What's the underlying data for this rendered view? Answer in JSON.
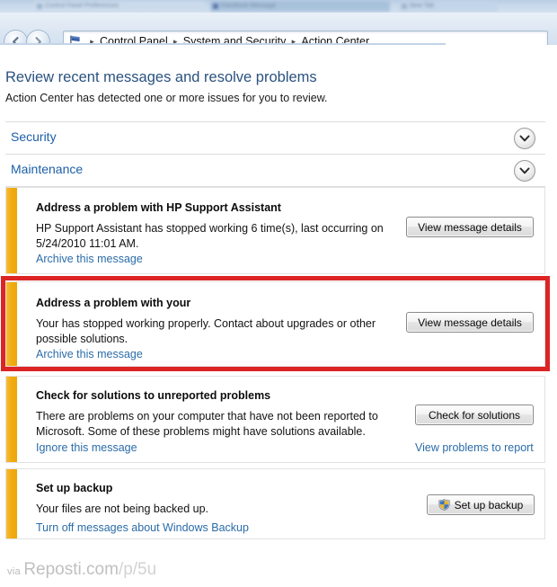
{
  "browser": {
    "tabs": [
      {
        "title": "Control Panel Preferences"
      },
      {
        "title": "Facebook Message"
      },
      {
        "title": "New Tab"
      }
    ]
  },
  "chrome": {
    "back_label": "Back",
    "forward_label": "Forward",
    "recent_pages_label": "Recent pages",
    "flag_icon": "action-center-flag-icon",
    "breadcrumb": {
      "separator": "▸",
      "items": [
        "Control Panel",
        "System and Security",
        "Action Center"
      ]
    }
  },
  "page": {
    "title": "Review recent messages and resolve problems",
    "subtitle": "Action Center has detected one or more issues for you to review."
  },
  "sections": [
    {
      "name": "security",
      "title": "Security",
      "expander_icon": "chevron-down-icon"
    },
    {
      "name": "maintenance",
      "title": "Maintenance",
      "expander_icon": "chevron-down-icon"
    }
  ],
  "messages": [
    {
      "title": "Address a problem with HP Support Assistant",
      "description": "HP Support Assistant has stopped working  6 time(s), last occurring on 5/24/2010 11:01 AM.",
      "link": "Archive this message",
      "button": "View message details",
      "button_icon": null,
      "right_link": null,
      "severity_color": "#f0ac12",
      "highlighted": false
    },
    {
      "title": "Address a problem with your",
      "description": "Your  has stopped working properly. Contact  about upgrades or other possible solutions.",
      "link": "Archive this message",
      "button": "View message details",
      "button_icon": null,
      "right_link": null,
      "severity_color": "#f0ac12",
      "highlighted": true
    },
    {
      "title": "Check for solutions to unreported problems",
      "description": "There are problems on your computer that have not been reported to Microsoft. Some of these problems might have solutions available.",
      "link": "Ignore this message",
      "button": "Check for solutions",
      "button_icon": null,
      "right_link": "View problems to report",
      "severity_color": "#f0ac12",
      "highlighted": false
    },
    {
      "title": "Set up backup",
      "description": "Your files are not being backed up.",
      "link": "Turn off messages about Windows Backup",
      "button": "Set up backup",
      "button_icon": "uac-shield-icon",
      "right_link": null,
      "severity_color": "#f0ac12",
      "highlighted": false
    }
  ],
  "annotation": {
    "highlight_color": "#dd2424",
    "target_message_index": 1
  },
  "watermark": {
    "prefix": "via",
    "domain": "Reposti.com",
    "path": "/p/5u"
  }
}
